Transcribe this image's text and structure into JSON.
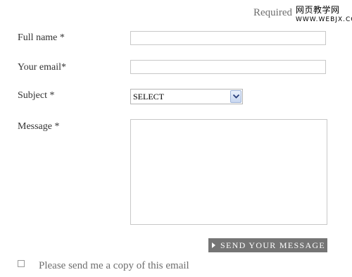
{
  "header": {
    "required_note": "Required",
    "watermark_text": "网页教学网",
    "watermark_url": "WWW.WEBJX.COM"
  },
  "form": {
    "fields": [
      {
        "label": "Full name *",
        "value": ""
      },
      {
        "label": "Your email*",
        "value": ""
      },
      {
        "label": "Subject *",
        "selected": "SELECT"
      },
      {
        "label": "Message *",
        "value": ""
      }
    ],
    "submit_label": "SEND YOUR MESSAGE",
    "copy_checkbox": {
      "label": "Please send me a copy of this email",
      "checked": false
    }
  }
}
